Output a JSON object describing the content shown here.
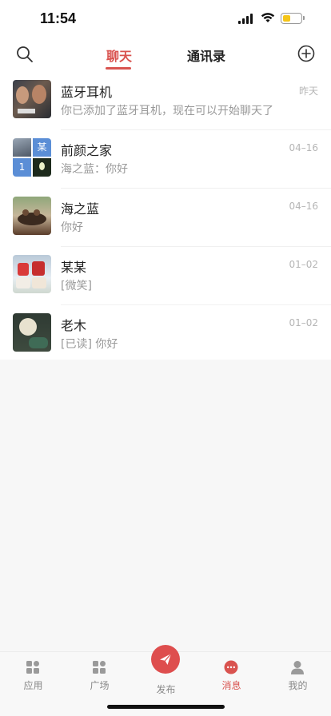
{
  "status": {
    "time": "11:54"
  },
  "header": {
    "tabs": [
      {
        "label": "聊天",
        "active": true
      },
      {
        "label": "通讯录",
        "active": false
      }
    ],
    "accent": "#d9534f"
  },
  "chats": [
    {
      "name": "蓝牙耳机",
      "preview": "你已添加了蓝牙耳机，现在可以开始聊天了",
      "time": "昨天"
    },
    {
      "name": "前颜之家",
      "preview": "海之蓝：你好",
      "time": "04–16",
      "group_badges": [
        "某",
        "1"
      ]
    },
    {
      "name": "海之蓝",
      "preview": "你好",
      "time": "04–16"
    },
    {
      "name": "某某",
      "preview": "[微笑]",
      "time": "01–02"
    },
    {
      "name": "老木",
      "preview": "[已读] 你好",
      "time": "01–02"
    }
  ],
  "tabbar": {
    "items": [
      {
        "label": "应用",
        "icon": "grid-icon"
      },
      {
        "label": "广场",
        "icon": "grid-icon"
      },
      {
        "label": "发布",
        "icon": "paper-plane-icon"
      },
      {
        "label": "消息",
        "icon": "chat-bubble-icon",
        "active": true
      },
      {
        "label": "我的",
        "icon": "person-icon"
      }
    ]
  }
}
